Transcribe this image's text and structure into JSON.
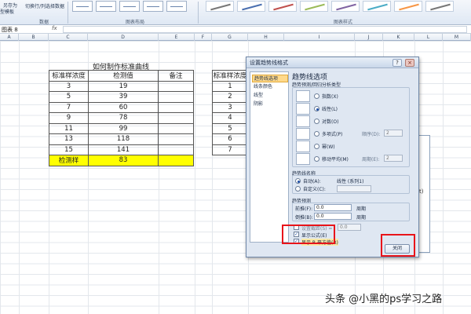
{
  "ribbon": {
    "save_as": "另存为",
    "template": "模板",
    "type_label": "型",
    "switch_rowcol": "切换行/列",
    "select_data": "选择数据",
    "group_data": "数据",
    "group_layout": "图表布局",
    "group_styles": "图表样式"
  },
  "formula_bar": {
    "name_box": "图表 8",
    "fx": "fx",
    "value": ""
  },
  "columns": [
    "A",
    "B",
    "C",
    "D",
    "E",
    "F",
    "G",
    "H",
    "I",
    "J",
    "K",
    "L",
    "M"
  ],
  "table1": {
    "title": "如何制作标准曲线",
    "headers": [
      "标准样浓度",
      "检测值",
      "备注"
    ],
    "rows": [
      [
        "3",
        "19",
        ""
      ],
      [
        "5",
        "39",
        ""
      ],
      [
        "7",
        "60",
        ""
      ],
      [
        "9",
        "78",
        ""
      ],
      [
        "11",
        "99",
        ""
      ],
      [
        "13",
        "118",
        ""
      ],
      [
        "15",
        "141",
        ""
      ]
    ],
    "sample_row": [
      "检测样",
      "83",
      ""
    ]
  },
  "table2": {
    "header": "标准样浓度",
    "rows": [
      "1",
      "2",
      "3",
      "4",
      "5",
      "6",
      "7"
    ]
  },
  "chart_fragment": "t)",
  "dialog": {
    "title": "设置趋势线格式",
    "help": "?",
    "close_x": "×",
    "nav": [
      "趋势线选项",
      "线条颜色",
      "线型",
      "阴影"
    ],
    "section_title": "趋势线选项",
    "type_heading": "趋势预测/回归分析类型",
    "types": [
      {
        "label": "指数(X)",
        "selected": false
      },
      {
        "label": "线性(L)",
        "selected": true
      },
      {
        "label": "对数(O)",
        "selected": false
      },
      {
        "label": "多项式(P)",
        "selected": false
      },
      {
        "label": "幂(W)",
        "selected": false
      },
      {
        "label": "移动平均(M)",
        "selected": false
      }
    ],
    "order_label": "顺序(D):",
    "order_value": "2",
    "period_label": "周期(E):",
    "period_value": "2",
    "name_heading": "趋势线名称",
    "name_auto": "自动(A):",
    "name_auto_value": "线性 (系列1)",
    "name_custom": "自定义(C):",
    "forecast_heading": "趋势预测",
    "forward_label": "前推(F):",
    "forward_value": "0.0",
    "backward_label": "倒推(B):",
    "backward_value": "0.0",
    "period_unit": "周期",
    "intercept_label": "设置截距(S) =",
    "intercept_value": "0.0",
    "show_equation": "显示公式(E)",
    "show_r2": "显示 R 平方值(R)",
    "close_button": "关闭"
  },
  "watermark": "头条 @小黑的ps学习之路",
  "colors": {
    "highlight_yellow": "#ffff00",
    "annotation_red": "#e8141a"
  }
}
